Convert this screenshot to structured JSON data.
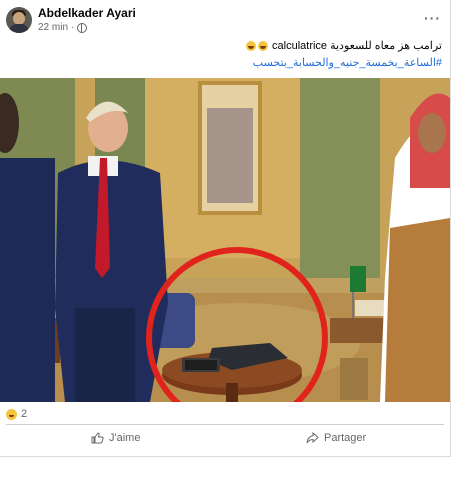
{
  "post": {
    "author": "Abdelkader Ayari",
    "time": "22 min",
    "privacy_icon": "globe-icon",
    "more_icon": "more-options-icon",
    "caption": "ترامب هز معاه للسعودية calculatrice",
    "hashtag": "#الساعة_بخمسة_جنيه_والحسابة_بتحسب"
  },
  "photo": {
    "description_icon": "post-photo"
  },
  "reactions": {
    "count": "2",
    "icon": "laughing-emoji-icon"
  },
  "actions": {
    "like_label": "J'aime",
    "share_label": "Partager",
    "like_icon": "thumbs-up-icon",
    "share_icon": "share-arrow-icon"
  },
  "colors": {
    "link": "#216fdb",
    "secondary_text": "#65676b",
    "highlight_circle": "#e0241c"
  }
}
